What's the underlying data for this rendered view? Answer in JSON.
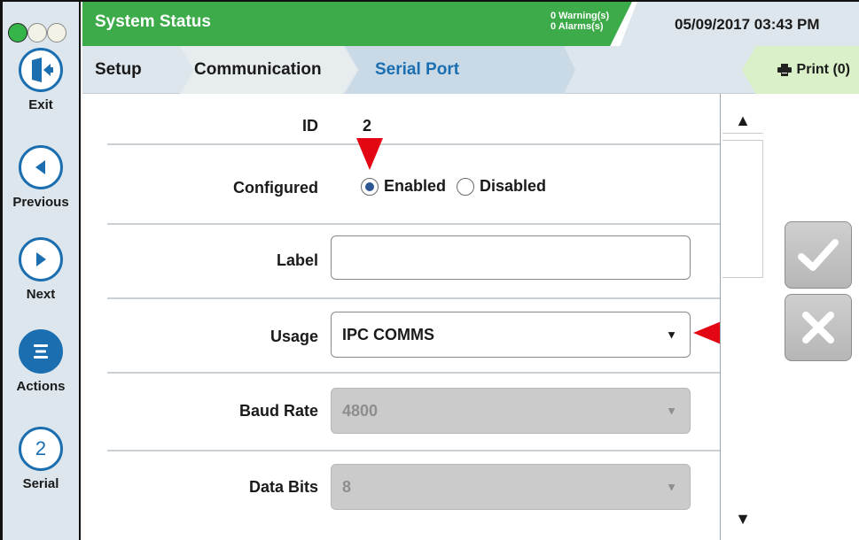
{
  "header": {
    "title": "System Status",
    "warnings": "0 Warning(s)",
    "alarms": "0 Alarms(s)",
    "datetime": "05/09/2017 03:43 PM"
  },
  "sidebar": {
    "items": [
      {
        "label": "Exit",
        "icon": "exit-icon"
      },
      {
        "label": "Previous",
        "icon": "previous-icon"
      },
      {
        "label": "Next",
        "icon": "next-icon"
      },
      {
        "label": "Actions",
        "icon": "actions-icon"
      },
      {
        "label": "Serial",
        "icon": "serial-number-icon",
        "number": "2"
      }
    ]
  },
  "breadcrumb": {
    "setup": "Setup",
    "communication": "Communication",
    "serial_port": "Serial Port"
  },
  "print": {
    "label": "Print (0)"
  },
  "form": {
    "id_label": "ID",
    "id_value": "2",
    "configured_label": "Configured",
    "configured_options": [
      "Enabled",
      "Disabled"
    ],
    "configured_selected": "Enabled",
    "label_label": "Label",
    "label_value": "",
    "usage_label": "Usage",
    "usage_value": "IPC COMMS",
    "baud_label": "Baud Rate",
    "baud_value": "4800",
    "databits_label": "Data Bits",
    "databits_value": "8"
  },
  "colors": {
    "header_green": "#3dab49",
    "accent_blue": "#1b6fb1",
    "panel_blue": "#dde6ec",
    "marker_red": "#e30613",
    "print_green": "#d9f0c9"
  }
}
